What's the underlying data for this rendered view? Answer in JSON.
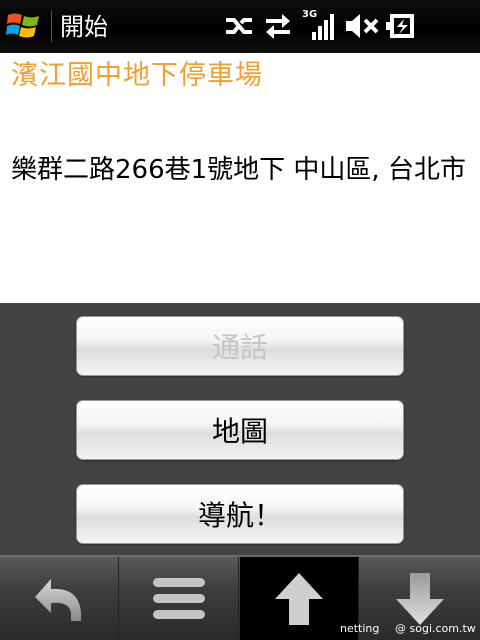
{
  "status_bar": {
    "start_label": "開始",
    "network_type": "3G",
    "icons": [
      "windows-logo",
      "connectivity-off-icon",
      "data-transfer-icon",
      "signal-strength-icon",
      "volume-muted-icon",
      "battery-icon"
    ]
  },
  "place": {
    "name": "濱江國中地下停車場",
    "address": "樂群二路266巷1號地下 中山區, 台北市"
  },
  "actions": {
    "call_label": "通話",
    "map_label": "地圖",
    "navigate_label": "導航！"
  },
  "toolbar": {
    "icons": [
      "back-icon",
      "menu-icon",
      "up-arrow-icon",
      "down-arrow-icon"
    ],
    "active": "up-arrow-icon"
  },
  "watermark": {
    "left": "netting",
    "right": "@ sogi.com.tw"
  },
  "colors": {
    "title": "#f0a030",
    "panel_bg": "#434343",
    "status_bg": "#000000"
  }
}
